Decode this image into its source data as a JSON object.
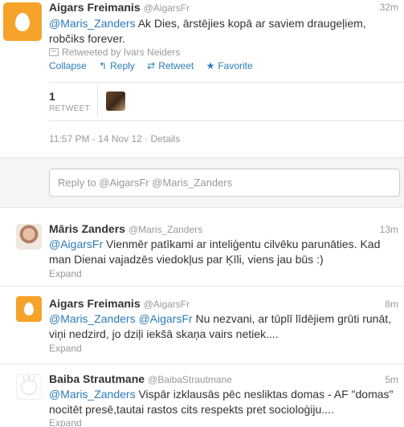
{
  "colors": {
    "accent": "#2b7bb9",
    "muted": "#999999",
    "egg_bg": "#f5a32a"
  },
  "expanded_tweet": {
    "fullname": "Aigars Freimanis",
    "username": "@AigarsFr",
    "time": "32m",
    "mention": "@Maris_Zanders",
    "text": " Ak Dies, ārstējies kopā ar saviem draugeļiem, robčiks forever.",
    "retweeted_by": "Retweeted by Ivars Neiders",
    "actions": {
      "collapse": "Collapse",
      "reply": "Reply",
      "retweet": "Retweet",
      "favorite": "Favorite"
    },
    "stats": {
      "retweet_count": "1",
      "retweet_label": "RETWEET"
    },
    "timestamp": "11:57 PM - 14 Nov 12",
    "details": "Details",
    "reply_placeholder": "Reply to @AigarsFr @Maris_Zanders"
  },
  "replies": [
    {
      "fullname": "Māris Zanders",
      "username": "@Maris_Zanders",
      "time": "13m",
      "mention1": "@AigarsFr",
      "text": " Vienmēr patīkami ar inteliģentu cilvēku parunāties. Kad man Dienai vajadzēs viedokļus par Ķīli, viens jau būs :)",
      "expand": "Expand"
    },
    {
      "fullname": "Aigars Freimanis",
      "username": "@AigarsFr",
      "time": "8m",
      "mention1": "@Maris_Zanders",
      "mention2": "@AigarsFr",
      "text": " Nu nezvani, ar tūplī līdējiem grūti runāt, viņi nedzird, jo dziļi iekšā skaņa vairs netiek....",
      "expand": "Expand"
    },
    {
      "fullname": "Baiba Strautmane",
      "username": "@BaibaStrautmane",
      "time": "5m",
      "mention1": "@Maris_Zanders",
      "text": " Vispār izklausās pēc nesliktas domas - AF \"domas\" nocitēt presē,tautai rastos cits respekts pret socioloģiju....",
      "expand": "Expand"
    }
  ]
}
